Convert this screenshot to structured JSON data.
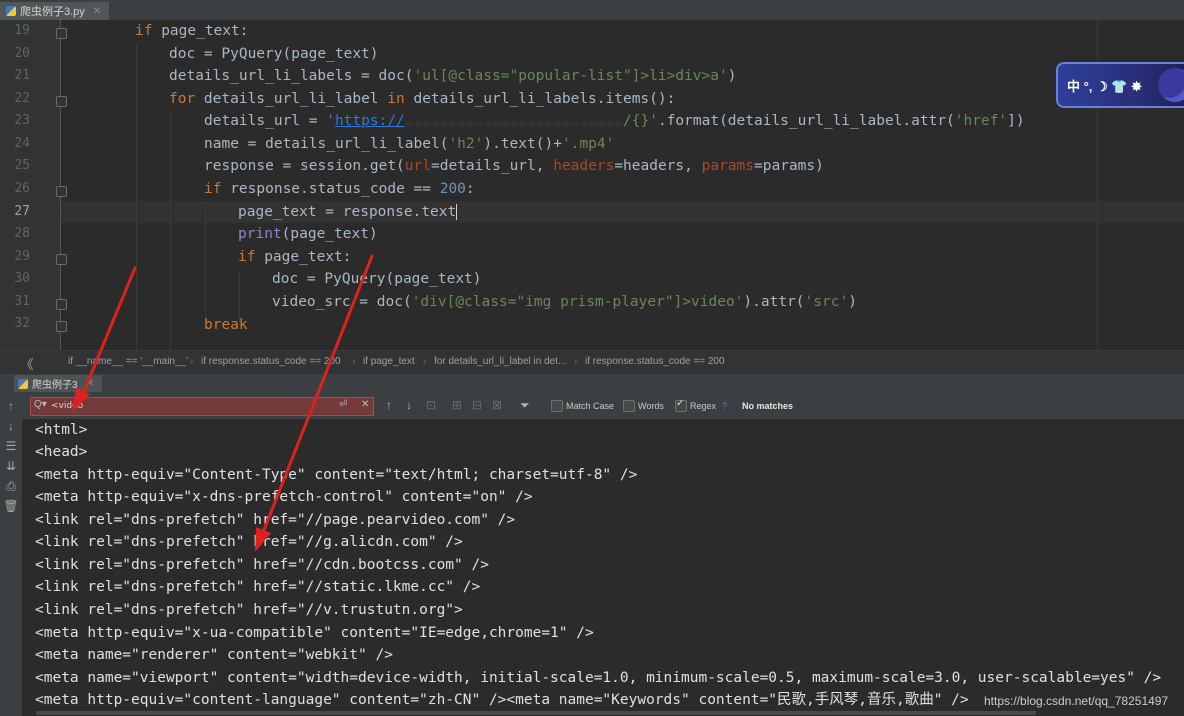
{
  "editor_tab": {
    "label": "爬虫例子3.py"
  },
  "line_numbers": [
    "19",
    "20",
    "21",
    "22",
    "23",
    "24",
    "25",
    "26",
    "27",
    "28",
    "29",
    "30",
    "31",
    "32"
  ],
  "code": {
    "l19": {
      "kw_if": "if",
      "rest": " page_text:"
    },
    "l20": {
      "a": "doc = PyQuery(page_text)"
    },
    "l21": {
      "a": "details_url_li_labels = doc(",
      "s": "'ul[@class=\"popular-list\"]>li>div>a'",
      "b": ")"
    },
    "l22": {
      "kw_for": "for",
      "a": " details_url_li_label ",
      "kw_in": "in",
      "b": " details_url_li_labels.items():"
    },
    "l23": {
      "a": "details_url = ",
      "q": "'",
      "url": "https://",
      "hidden": ".........................",
      "s2": "/{}'",
      "b": ".format(details_url_li_label.attr(",
      "s3": "'href'",
      "c": "])"
    },
    "l24": {
      "a": "name = details_url_li_label(",
      "s": "'h2'",
      "b": ").",
      "m": "text",
      "c": "()+",
      "s2": "'.mp4'"
    },
    "l25": {
      "a": "response = session.get(",
      "k1": "url",
      "b": "=details_url, ",
      "k2": "headers",
      "c": "=headers, ",
      "k3": "params",
      "d": "=params)"
    },
    "l26": {
      "kw_if": "if",
      "a": " response.status_code == ",
      "n": "200",
      "b": ":"
    },
    "l27": {
      "a": "page_text = response.",
      "m": "text"
    },
    "l28": {
      "bi": "print",
      "a": "(page_text)"
    },
    "l29": {
      "kw_if": "if",
      "a": " page_text:"
    },
    "l30": {
      "a": "doc = PyQuery(page_text)"
    },
    "l31": {
      "a": "video_src = doc(",
      "s": "'div[@class=\"img prism-player\"]>video'",
      "b": ").attr(",
      "s2": "'src'",
      "c": ")"
    },
    "l32": {
      "kw": "break"
    }
  },
  "breadcrumb": [
    "if __name__ == '__main__'",
    "if response.status_code == 200",
    "if page_text",
    "for details_url_li_label in det...",
    "if response.status_code == 200"
  ],
  "run_tab": {
    "label": "爬虫例子3"
  },
  "find_bar": {
    "search_value": "<video",
    "match_case": "Match Case",
    "words": "Words",
    "regex": "Regex",
    "help": "?",
    "status": "No matches",
    "regex_checked": true,
    "match_case_checked": false,
    "words_checked": false
  },
  "console_lines": [
    "<html>",
    "<head>",
    "<meta http-equiv=\"Content-Type\" content=\"text/html; charset=utf-8\" />",
    "<meta http-equiv=\"x-dns-prefetch-control\" content=\"on\" />",
    "<link rel=\"dns-prefetch\" href=\"//page.pearvideo.com\" />",
    "<link rel=\"dns-prefetch\" href=\"//g.alicdn.com\" />",
    "<link rel=\"dns-prefetch\" href=\"//cdn.bootcss.com\" />",
    "<link rel=\"dns-prefetch\" href=\"//static.lkme.cc\" />",
    "<link rel=\"dns-prefetch\" href=\"//v.trustutn.org\">",
    "<meta http-equiv=\"x-ua-compatible\" content=\"IE=edge,chrome=1\" />",
    "<meta name=\"renderer\" content=\"webkit\" />",
    "<meta name=\"viewport\" content=\"width=device-width, initial-scale=1.0, minimum-scale=0.5, maximum-scale=3.0, user-scalable=yes\" />",
    "<meta http-equiv=\"content-language\" content=\"zh-CN\" /><meta name=\"Keywords\" content=\"民歌,手风琴,音乐,歌曲\" />"
  ],
  "watermark": "https://blog.csdn.net/qq_78251497",
  "ime": {
    "text": "中 °, ☽ 👕 ✸"
  },
  "colors": {
    "annotation_arrow": "#e0201e",
    "search_error_bg": "#743a3a",
    "keyword": "#cc7832",
    "string": "#6a8759",
    "number": "#6897bb"
  },
  "icons": {
    "tab": "python-file-icon",
    "run": "python-run-icon",
    "search": "search-icon",
    "collapse": "double-chevron-left-icon"
  }
}
